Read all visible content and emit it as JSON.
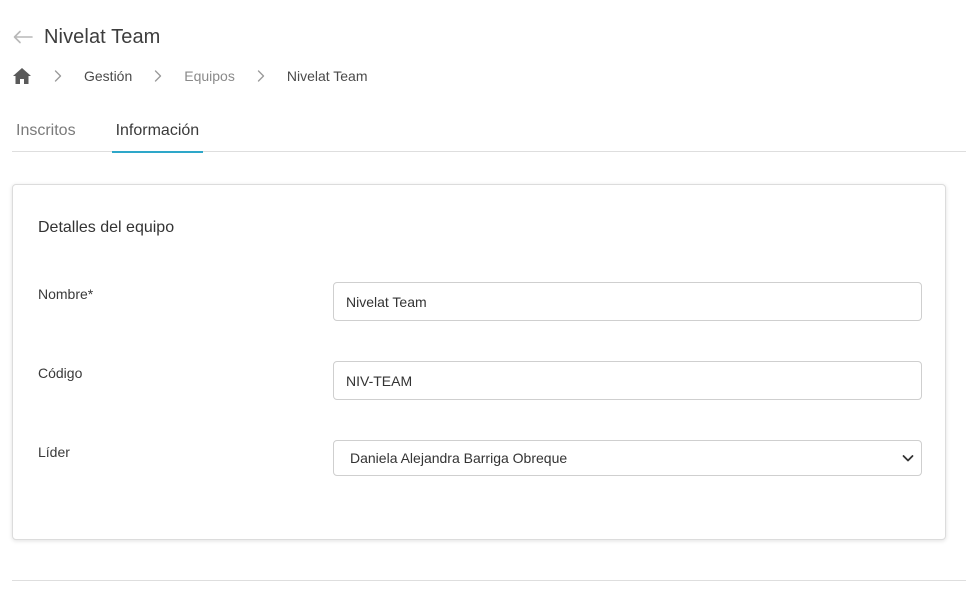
{
  "header": {
    "back_icon": "arrow-left-icon",
    "title": "Nivelat Team"
  },
  "breadcrumb": {
    "home_icon": "home-icon",
    "separator_icon": "chevron-right-icon",
    "items": [
      {
        "label": "Gestión"
      },
      {
        "label": "Equipos"
      },
      {
        "label": "Nivelat Team"
      }
    ]
  },
  "tabs": [
    {
      "label": "Inscritos",
      "active": false
    },
    {
      "label": "Información",
      "active": true
    }
  ],
  "card": {
    "title": "Detalles del equipo",
    "fields": {
      "nombre": {
        "label": "Nombre*",
        "value": "Nivelat Team"
      },
      "codigo": {
        "label": "Código",
        "value": "NIV-TEAM"
      },
      "lider": {
        "label": "Líder",
        "value": "Daniela Alejandra Barriga Obreque"
      }
    }
  },
  "colors": {
    "accent": "#2ea7c9",
    "border": "#dedede",
    "muted_text": "#8a8a8a"
  }
}
